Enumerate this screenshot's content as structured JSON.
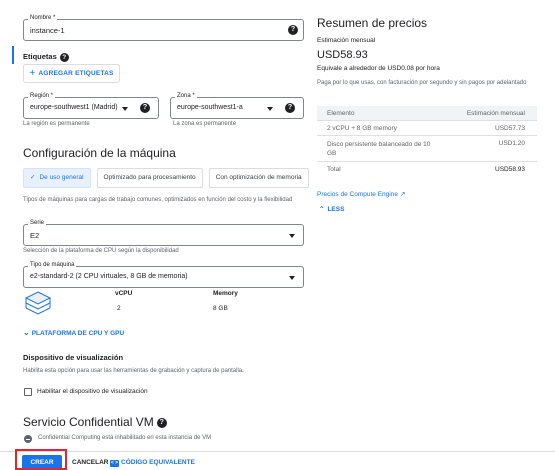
{
  "form": {
    "name": {
      "label": "Nombre *",
      "value": "instance-1"
    },
    "labels": {
      "title": "Etiquetas",
      "add_button": "AGREGAR ETIQUETAS"
    },
    "region": {
      "label": "Región *",
      "value": "europe-southwest1 (Madrid)",
      "hint": "La región es permanente"
    },
    "zone": {
      "label": "Zona *",
      "value": "europe-southwest1-a",
      "hint": "La zona es permanente"
    },
    "machine_config": {
      "title": "Configuración de la máquina",
      "tabs": [
        {
          "label": "De uso general",
          "active": true
        },
        {
          "label": "Optimizado para procesamiento",
          "active": false
        },
        {
          "label": "Con optimización de memoria",
          "active": false
        }
      ],
      "description": "Tipos de máquinas para cargas de trabajo comunes, optimizados en función del costo y la flexibilidad",
      "series": {
        "label": "Serie",
        "value": "E2",
        "hint": "Selección de la plataforma de CPU según la disponibilidad"
      },
      "machine_type": {
        "label": "Tipo de máquina",
        "value": "e2-standard-2 (2 CPU virtuales, 8 GB de memoria)"
      },
      "specs": {
        "vcpu_header": "vCPU",
        "memory_header": "Memory",
        "vcpu_value": "2",
        "memory_value": "8 GB"
      },
      "cpu_platform_link": "PLATAFORMA DE CPU Y GPU"
    },
    "display_device": {
      "title": "Dispositivo de visualización",
      "description": "Habilita esta opción para usar las herramientas de grabación y captura de pantalla.",
      "checkbox_label": "Habilitar el dispositivo de visualización",
      "checked": false
    },
    "confidential_vm": {
      "title": "Servicio Confidential VM",
      "status": "Confidential Computing está inhabilitado en esta instancia de VM"
    }
  },
  "actions": {
    "create": "CREAR",
    "cancel": "CANCELAR",
    "equivalent_code": "CÓDIGO EQUIVALENTE",
    "code_icon": "< >"
  },
  "pricing": {
    "title": "Resumen de precios",
    "monthly_label": "Estimación mensual",
    "monthly_value": "USD58.93",
    "hourly": "Equivale a alrededor de USD0.08 por hora",
    "note": "Paga por lo que usas, con facturación por segundo y sin pagos por adelantado",
    "table_headers": [
      "Elemento",
      "Estimación mensual"
    ],
    "rows": [
      {
        "item": "2 vCPU + 8 GB memory",
        "cost": "USD57.73"
      },
      {
        "item": "Disco persistente balanceado de 10 GB",
        "cost": "USD1.20"
      }
    ],
    "total_label": "Total",
    "total_value": "USD58.93",
    "pricing_link": "Precios de Compute Engine",
    "less_link": "LESS"
  },
  "colors": {
    "accent": "#1a73e8",
    "highlight": "#e8242b"
  }
}
